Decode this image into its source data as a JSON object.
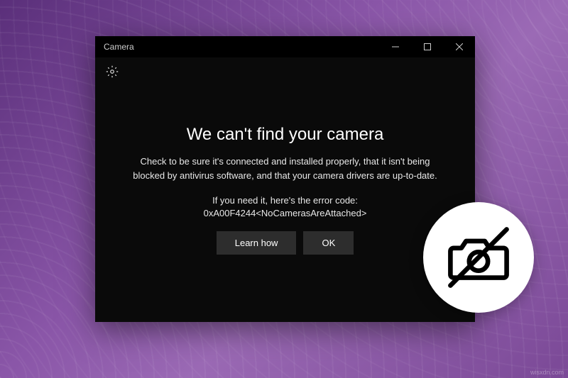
{
  "window": {
    "title": "Camera",
    "controls": {
      "minimize": "—",
      "maximize": "▢",
      "close": "✕"
    }
  },
  "error": {
    "heading": "We can't find your camera",
    "description": "Check to be sure it's connected and installed properly, that it isn't being blocked by antivirus software, and that your camera drivers are up-to-date.",
    "code_label": "If you need it, here's the error code:",
    "code": "0xA00F4244<NoCamerasAreAttached>",
    "buttons": {
      "learn": "Learn how",
      "ok": "OK"
    }
  },
  "watermark": "wisxdn.com"
}
